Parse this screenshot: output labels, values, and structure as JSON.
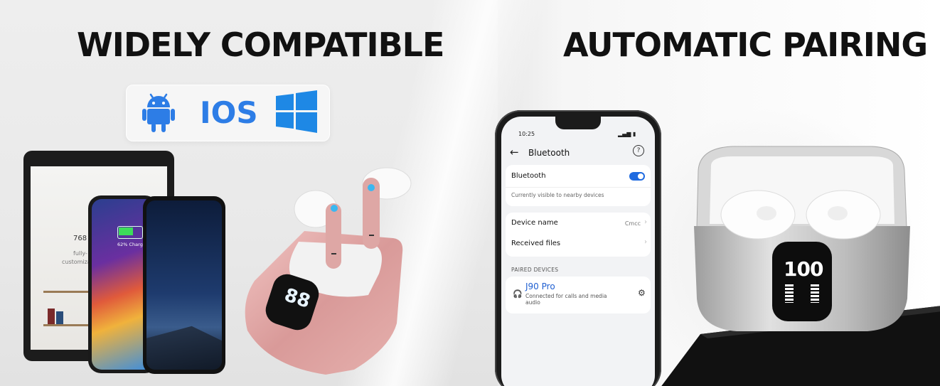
{
  "headlines": {
    "left": "WIDELY COMPATIBLE",
    "right": "AUTOMATIC PAIRING"
  },
  "os_badges": {
    "icons": [
      "android-icon",
      "windows-icon"
    ],
    "ios_label": "IOS"
  },
  "tablet": {
    "screen_text_1": "768 x 1",
    "screen_text_2": "fully-",
    "screen_text_3": "customizable"
  },
  "phone_left": {
    "charge_text": "62% Charge"
  },
  "earbud_displays": {
    "pink_case_digits": "88",
    "silver_case_digits": "100"
  },
  "settings_phone": {
    "status_time": "10:25",
    "title": "Bluetooth",
    "bluetooth_label": "Bluetooth",
    "bluetooth_on": true,
    "visibility_text": "Currently visible to nearby devices",
    "device_name_label": "Device name",
    "device_name_value": "Cmcc",
    "received_files_label": "Received files",
    "paired_header": "PAIRED DEVICES",
    "paired_device_name": "J90 Pro",
    "paired_device_status": "Connected for calls and media audio"
  },
  "colors": {
    "accent_blue": "#2d7de6",
    "windows_blue": "#1e88e5",
    "rose_gold": "#e2a9a9",
    "silver": "#c9c9c9"
  }
}
